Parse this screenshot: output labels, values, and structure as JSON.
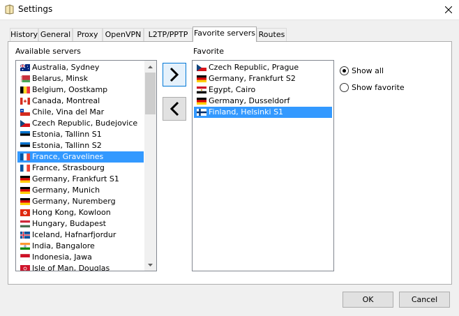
{
  "window": {
    "title": "Settings"
  },
  "tabs": [
    {
      "label": "History"
    },
    {
      "label": "General"
    },
    {
      "label": "Proxy"
    },
    {
      "label": "OpenVPN"
    },
    {
      "label": "L2TP/PPTP"
    },
    {
      "label": "Favorite servers"
    },
    {
      "label": "Routes"
    }
  ],
  "active_tab": "Favorite servers",
  "available": {
    "label": "Available servers",
    "selected": "France, Gravelines",
    "items": [
      {
        "name": "Australia, Sydney",
        "flag": "au"
      },
      {
        "name": "Belarus, Minsk",
        "flag": "by"
      },
      {
        "name": "Belgium, Oostkamp",
        "flag": "be"
      },
      {
        "name": "Canada, Montreal",
        "flag": "ca"
      },
      {
        "name": "Chile, Vina del Mar",
        "flag": "cl"
      },
      {
        "name": "Czech Republic, Budejovice",
        "flag": "cz"
      },
      {
        "name": "Estonia, Tallinn S1",
        "flag": "ee"
      },
      {
        "name": "Estonia, Tallinn S2",
        "flag": "ee"
      },
      {
        "name": "France, Gravelines",
        "flag": "fr"
      },
      {
        "name": "France, Strasbourg",
        "flag": "fr"
      },
      {
        "name": "Germany, Frankfurt S1",
        "flag": "de"
      },
      {
        "name": "Germany, Munich",
        "flag": "de"
      },
      {
        "name": "Germany, Nuremberg",
        "flag": "de"
      },
      {
        "name": "Hong Kong, Kowloon",
        "flag": "hk"
      },
      {
        "name": "Hungary, Budapest",
        "flag": "hu"
      },
      {
        "name": "Iceland, Hafnarfjordur",
        "flag": "is"
      },
      {
        "name": "India, Bangalore",
        "flag": "in"
      },
      {
        "name": "Indonesia, Jawa",
        "flag": "id"
      },
      {
        "name": "Isle of Man, Douglas",
        "flag": "im"
      }
    ]
  },
  "favorite": {
    "label": "Favorite",
    "selected": "Finland, Helsinki S1",
    "items": [
      {
        "name": "Czech Republic, Prague",
        "flag": "cz"
      },
      {
        "name": "Germany, Frankfurt S2",
        "flag": "de"
      },
      {
        "name": "Egypt, Cairo",
        "flag": "eg"
      },
      {
        "name": "Germany, Dusseldorf",
        "flag": "de"
      },
      {
        "name": "Finland, Helsinki S1",
        "flag": "fi"
      }
    ]
  },
  "move_buttons": {
    "add_icon": "chevron-right-icon",
    "remove_icon": "chevron-left-icon"
  },
  "view_options": [
    {
      "label": "Show all",
      "checked": true
    },
    {
      "label": "Show favorite",
      "checked": false
    }
  ],
  "buttons": {
    "ok": "OK",
    "cancel": "Cancel"
  },
  "colors": {
    "selection": "#3399ff",
    "focus": "#0078d7"
  }
}
